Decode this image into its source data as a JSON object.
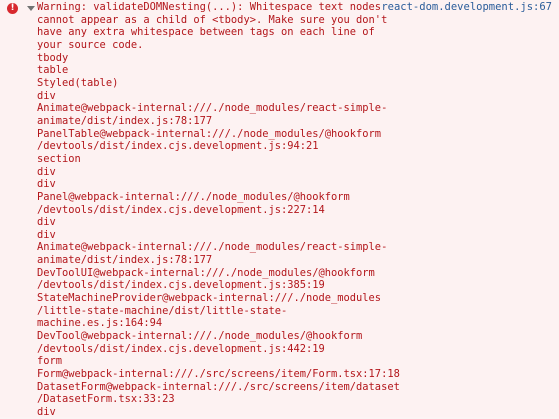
{
  "console": {
    "error": {
      "icon": "error-icon",
      "icon_glyph": "!",
      "source": "react-dom.development.js:67",
      "message_lines": [
        "Warning: validateDOMNesting(...): Whitespace text nodes",
        "cannot appear as a child of <tbody>. Make sure you don't",
        "have any extra whitespace between tags on each line of",
        "your source code.",
        "tbody",
        "table",
        "Styled(table)",
        "div",
        "Animate@webpack-internal:///./node_modules/react-simple-",
        "animate/dist/index.js:78:177",
        "PanelTable@webpack-internal:///./node_modules/@hookform",
        "/devtools/dist/index.cjs.development.js:94:21",
        "section",
        "div",
        "div",
        "Panel@webpack-internal:///./node_modules/@hookform",
        "/devtools/dist/index.cjs.development.js:227:14",
        "div",
        "div",
        "Animate@webpack-internal:///./node_modules/react-simple-",
        "animate/dist/index.js:78:177",
        "DevToolUI@webpack-internal:///./node_modules/@hookform",
        "/devtools/dist/index.cjs.development.js:385:19",
        "StateMachineProvider@webpack-internal:///./node_modules",
        "/little-state-machine/dist/little-state-",
        "machine.es.js:164:94",
        "DevTool@webpack-internal:///./node_modules/@hookform",
        "/devtools/dist/index.cjs.development.js:442:19",
        "form",
        "Form@webpack-internal:///./src/screens/item/Form.tsx:17:18",
        "DatasetForm@webpack-internal:///./src/screens/item/dataset",
        "/DatasetForm.tsx:33:23",
        "div"
      ]
    }
  },
  "colors": {
    "background": "#fdf2f2",
    "error_text": "#b3161b",
    "link": "#2a5c9a",
    "error_icon": "#d8282e"
  }
}
